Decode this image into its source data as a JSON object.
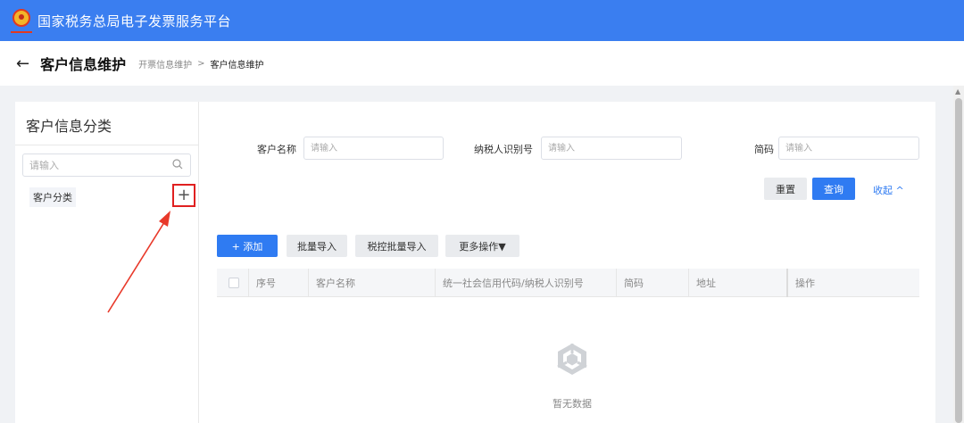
{
  "app": {
    "title": "国家税务总局电子发票服务平台"
  },
  "header": {
    "title": "客户信息维护",
    "breadcrumb": [
      "开票信息维护",
      "客户信息维护"
    ],
    "separator": ">"
  },
  "sidebar": {
    "title": "客户信息分类",
    "search_placeholder": "请输入",
    "category": "客户分类",
    "add_label": "+"
  },
  "filters": {
    "customer_name_label": "客户名称",
    "customer_name_placeholder": "请输入",
    "taxpayer_id_label": "纳税人识别号",
    "taxpayer_id_placeholder": "请输入",
    "short_code_label": "简码",
    "short_code_placeholder": "请输入",
    "reset": "重置",
    "query": "查询",
    "collapse": "收起 ^"
  },
  "toolbar": {
    "add": "+ 添加",
    "bulk_import": "批量导入",
    "tax_bulk_import": "税控批量导入",
    "more": "更多操作▼"
  },
  "table": {
    "columns": [
      "序号",
      "客户名称",
      "统一社会信用代码/纳税人识别号",
      "简码",
      "地址",
      "操作"
    ],
    "empty_text": "暂无数据"
  },
  "colors": {
    "topbar": "#3a7ef0",
    "primary": "#2f7bf2",
    "highlight": "#e02020"
  }
}
